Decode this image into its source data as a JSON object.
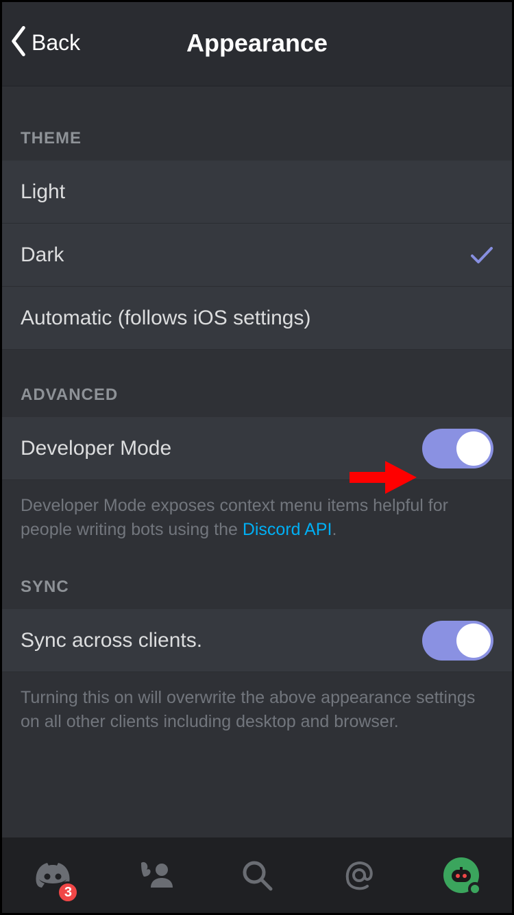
{
  "header": {
    "back_label": "Back",
    "title": "Appearance"
  },
  "sections": {
    "theme": {
      "header": "THEME",
      "options": [
        {
          "label": "Light",
          "selected": false
        },
        {
          "label": "Dark",
          "selected": true
        },
        {
          "label": "Automatic (follows iOS settings)",
          "selected": false
        }
      ]
    },
    "advanced": {
      "header": "ADVANCED",
      "dev_mode": {
        "label": "Developer Mode",
        "enabled": true
      },
      "dev_mode_desc_pre": "Developer Mode exposes context menu items helpful for people writing bots using the ",
      "dev_mode_link": "Discord API",
      "dev_mode_desc_post": "."
    },
    "sync": {
      "header": "SYNC",
      "sync_row": {
        "label": "Sync across clients.",
        "enabled": true
      },
      "sync_desc": "Turning this on will overwrite the above appearance settings on all other clients including desktop and browser."
    }
  },
  "tabbar": {
    "badge_count": "3"
  },
  "colors": {
    "accent": "#8a91e2",
    "link": "#00aff4",
    "badge": "#f04747",
    "check": "#878fe0",
    "online": "#3ba55d"
  }
}
